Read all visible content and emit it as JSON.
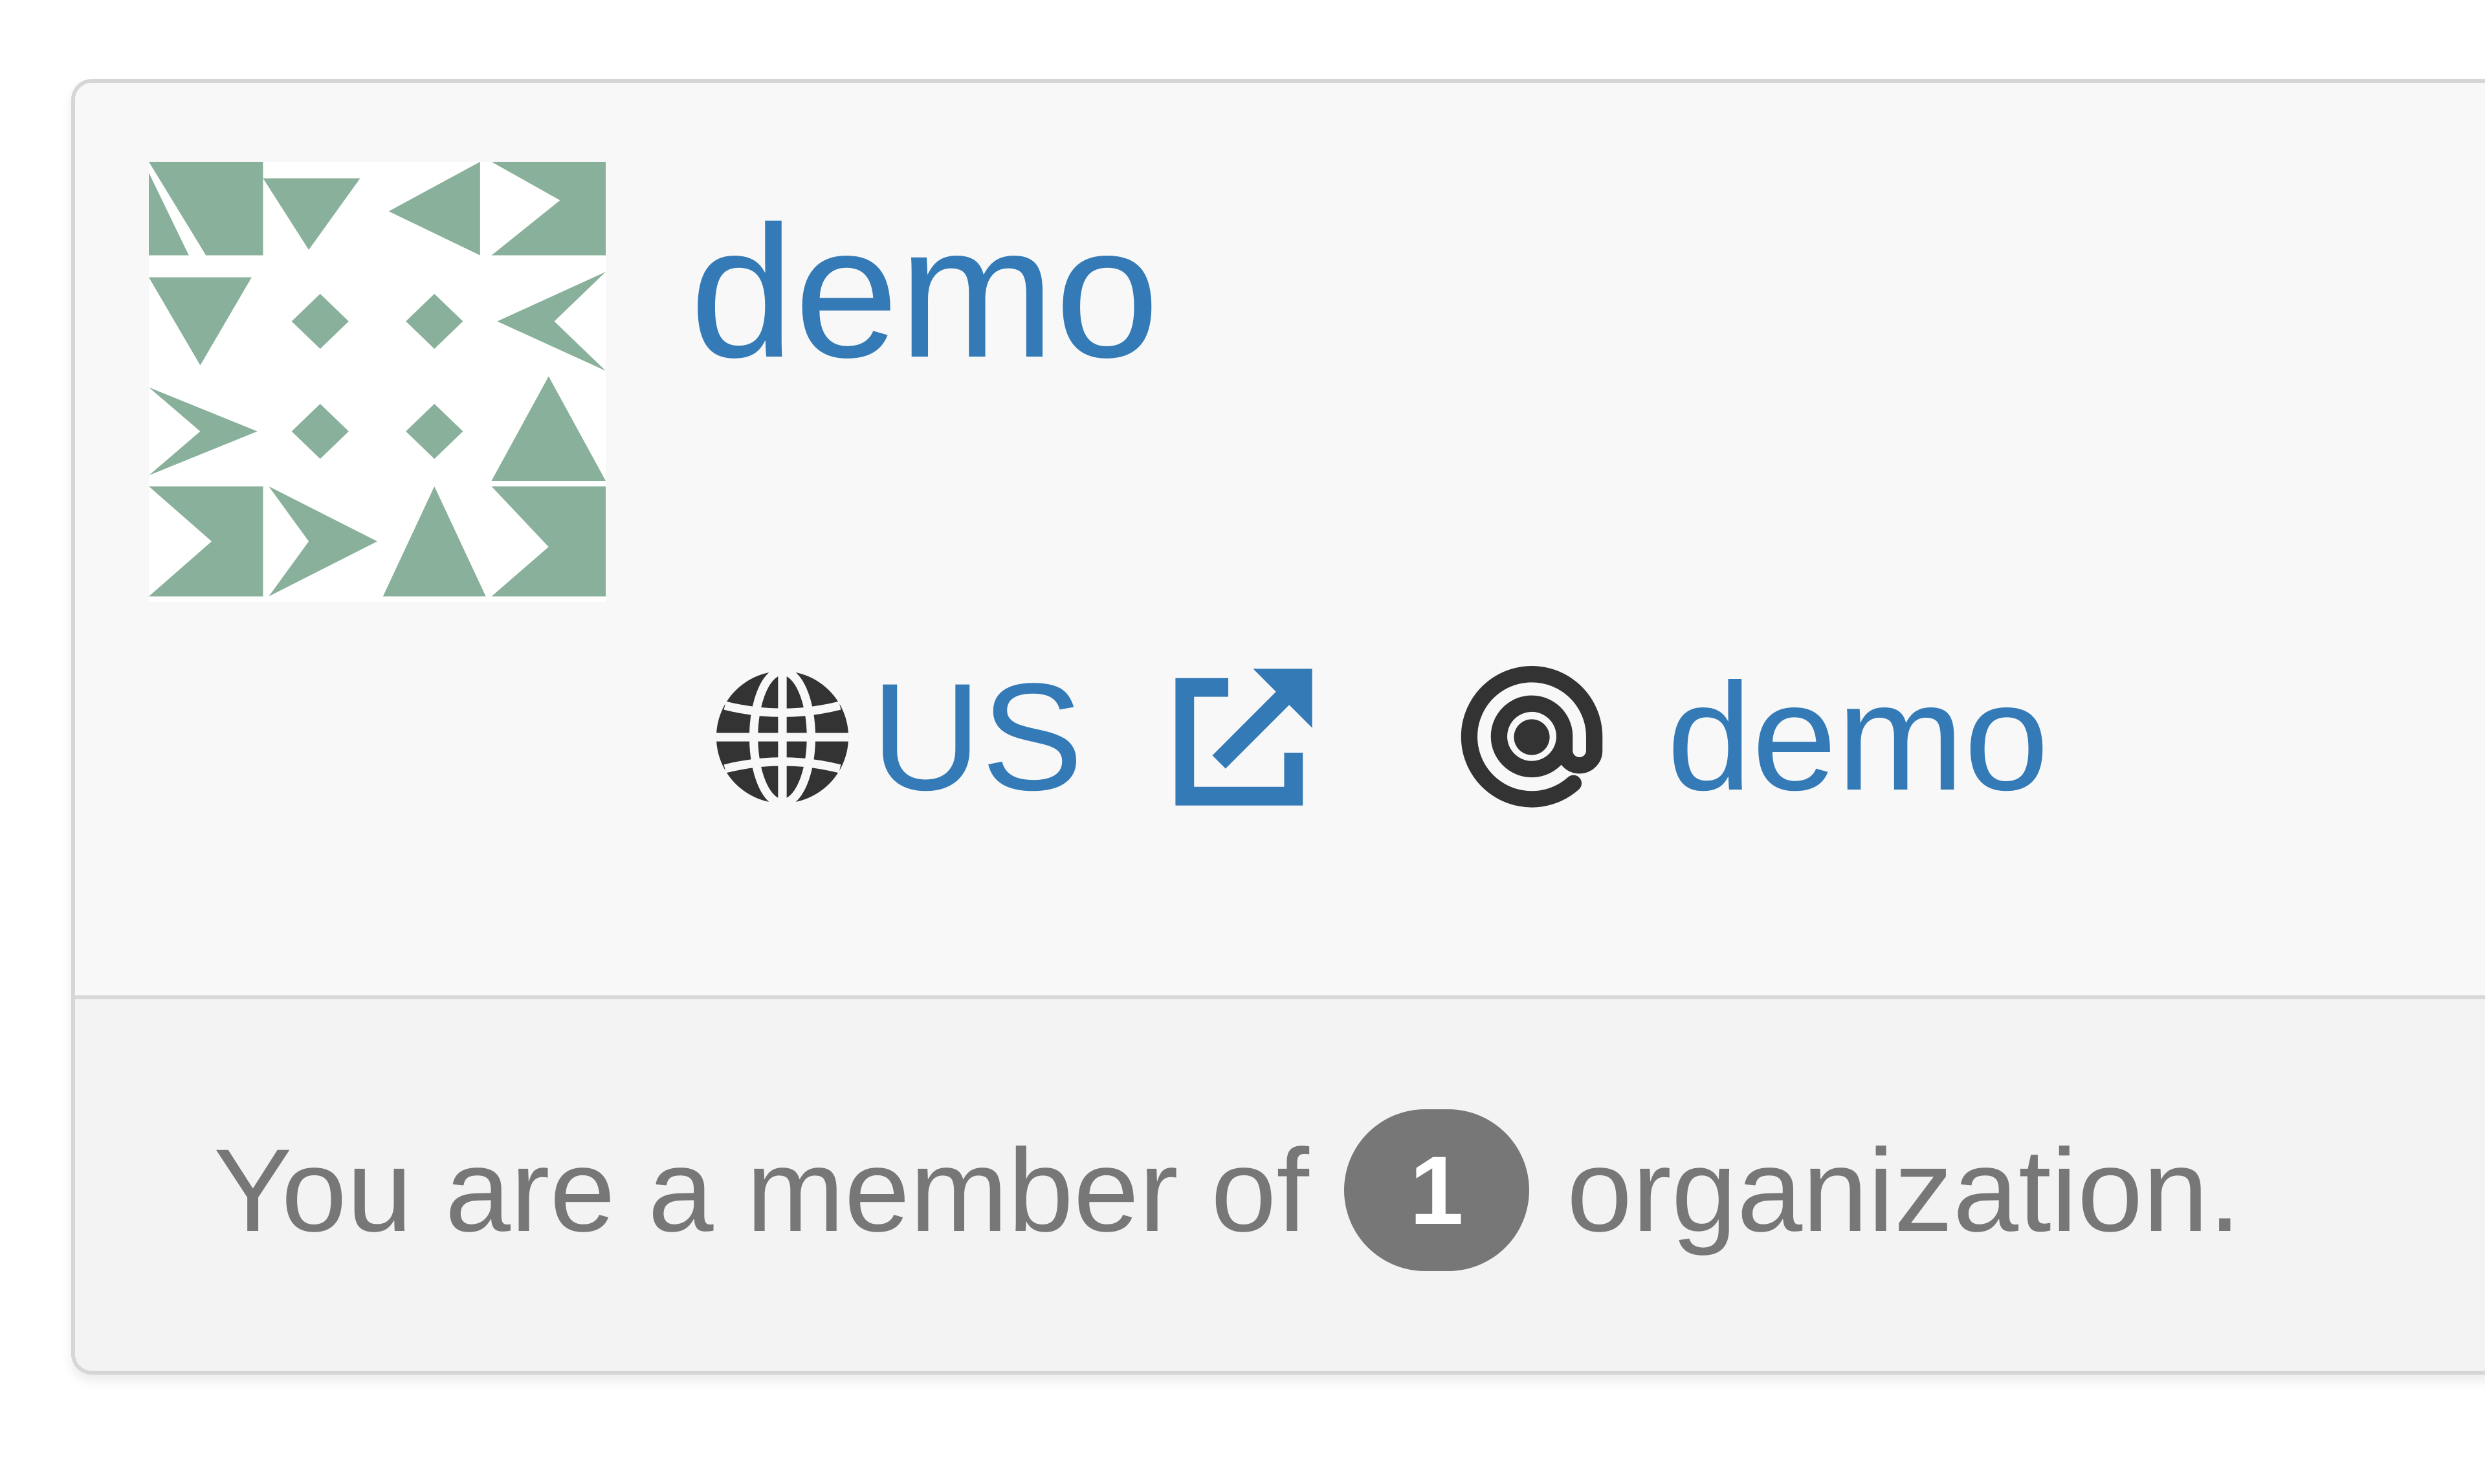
{
  "profile": {
    "username": "demo",
    "country": "US",
    "handle": "demo"
  },
  "icons": {
    "globe": "globe-icon",
    "external": "external-link-icon",
    "at": "at-icon"
  },
  "membership": {
    "prefix": "You are a member of",
    "count": "1",
    "suffix": "organization."
  },
  "colors": {
    "link": "#337ab7",
    "muted": "#777777",
    "avatar_pattern": "#88b09a"
  }
}
